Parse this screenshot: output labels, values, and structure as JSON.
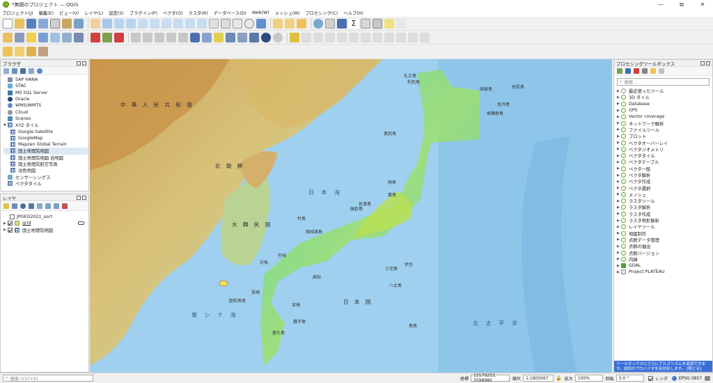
{
  "window": {
    "title": "*無題のプロジェクト — QGIS",
    "minimize": "—",
    "restore": "⧉",
    "close": "✕"
  },
  "menu": [
    "プロジェクト(J)",
    "編集(E)",
    "ビュー(V)",
    "レイヤ(L)",
    "設定(S)",
    "プラグイン(P)",
    "ベクタ(O)",
    "ラスタ(R)",
    "データベース(D)",
    "Web(W)",
    "メッシュ(M)",
    "プロセシング(C)",
    "ヘルプ(H)"
  ],
  "browser": {
    "title": "ブラウザ",
    "items": [
      "SAP HANA",
      "STAC",
      "MS SQL Server",
      "Oracle",
      "WMS/WMTS",
      "Cloud",
      "Scenes",
      "XYZ タイル",
      "Google Satellite",
      "GoogleMap",
      "Mapzen Global Terrain",
      "国土地理院地図",
      "国土地理院地図 自地図",
      "国土地理院航空写真",
      "淡色地図",
      "センサーシングス",
      "ベクタタイル"
    ]
  },
  "layers": {
    "title": "レイヤ",
    "items": [
      {
        "name": "JPGEO2021_sort",
        "checked": false
      },
      {
        "name": "grid",
        "checked": true
      },
      {
        "name": "国土地理院地図",
        "checked": true
      }
    ]
  },
  "toolbox": {
    "title": "プロセシングツールボックス",
    "search_placeholder": "検索...",
    "items": [
      "最近使ったツール",
      "3D タイル",
      "Database",
      "GPS",
      "Vector coverage",
      "ネットワーク解析",
      "ファイルツール",
      "プロット",
      "ベクタオーバーレイ",
      "ベクタジオメトリ",
      "ベクタタイル",
      "ベクタテーブル",
      "ベクタ一般",
      "ベクタ解析",
      "ベクタ作成",
      "ベクタ選択",
      "メッシュ",
      "ラスタツール",
      "ラスタ解析",
      "ラスタ作成",
      "ラスタ地形解析",
      "レイヤツール",
      "地図制作",
      "点群データ管理",
      "点群の抽出",
      "点群バージョン",
      "内挿",
      "GDAL",
      "Project PLATEAU"
    ],
    "notice": "ツールボックスにさらにアルゴリズムを追加できます。追加のプロバイダを有効化します。 [閉じる]"
  },
  "map_labels": {
    "china": "中 華 人 民 共 和 国",
    "north_korea": "北 朝 鮮",
    "south_korea": "大 韓 民 国",
    "sea_of_japan": "日 本 海",
    "east_china_sea": "東 シ ナ 海",
    "japan": "日 本 国",
    "pacific": "北 太 平 洋",
    "rebun": "礼文島",
    "rishiri": "利尻島",
    "kunashiri": "国後島",
    "etorofu": "択捉島",
    "shikotan": "色丹島",
    "habomai": "歯舞群島",
    "okushiri": "奥尻島",
    "tobishima": "飛島",
    "awashima": "粟島",
    "sado": "佐渡島",
    "noto": "舳倉島",
    "oki": "隠岐諸島",
    "takeshima": "竹島",
    "tsushima": "対馬",
    "iki": "壱岐",
    "goto": "五島列島",
    "koshiki": "甑島",
    "tanegashima": "種子島",
    "yakushima": "屋久島",
    "hachijo": "八丈島",
    "miyake": "三宅島",
    "izu": "伊豆",
    "tokyo_island": "鳥島",
    "danjo": "肥前鳥島",
    "nagasaki": "長崎",
    "miyazaki": "宮崎",
    "kochi": "高知"
  },
  "status": {
    "search_placeholder": "検索 (Ctrl+K)",
    "coord_label": "座標",
    "coord_value": "15570253, 3598980",
    "scale_label": "縮尺",
    "scale_value": "1:1805067",
    "lock": "🔒",
    "magnify_label": "拡大",
    "magnify_value": "100%",
    "rotation_label": "回転",
    "rotation_value": "0.0 °",
    "render_label": "レンダ",
    "crs": "EPSG:3857"
  }
}
